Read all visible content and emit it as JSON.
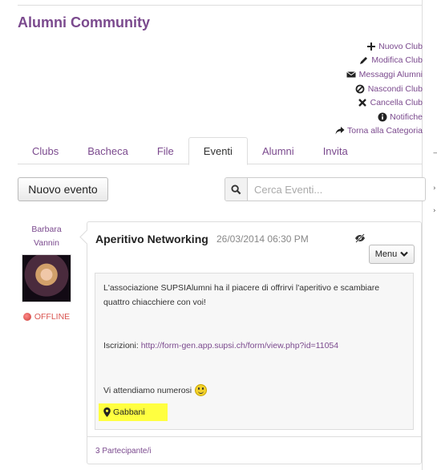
{
  "page": {
    "title": "Alumni Community"
  },
  "actions": [
    {
      "label": "Nuovo Club",
      "icon": "plus-icon"
    },
    {
      "label": "Modifica Club",
      "icon": "pencil-icon"
    },
    {
      "label": "Messaggi Alumni",
      "icon": "envelope-icon"
    },
    {
      "label": "Nascondi Club",
      "icon": "ban-icon"
    },
    {
      "label": "Cancella Club",
      "icon": "close-icon"
    },
    {
      "label": "Notifiche",
      "icon": "info-icon"
    },
    {
      "label": "Torna alla Categoria",
      "icon": "share-icon"
    }
  ],
  "tabs": [
    {
      "label": "Clubs"
    },
    {
      "label": "Bacheca"
    },
    {
      "label": "File"
    },
    {
      "label": "Eventi",
      "active": true
    },
    {
      "label": "Alumni"
    },
    {
      "label": "Invita"
    }
  ],
  "toolbar": {
    "new_event_label": "Nuovo evento"
  },
  "search": {
    "placeholder": "Cerca Eventi..."
  },
  "author": {
    "first_name": "Barbara",
    "last_name": "Vannin",
    "status": "OFFLINE"
  },
  "event": {
    "title": "Aperitivo Networking",
    "date": "26/03/2014 06:30 PM",
    "menu_label": "Menu",
    "intro": "L'associazione SUPSIAlumni ha il piacere di offrirvi l'aperitivo e  scambiare quattro chiacchiere con voi!",
    "signup_label": "Iscrizioni:",
    "signup_link": "http://form-gen.app.supsi.ch/form/view.php?id=11054",
    "closing": "Vi attendiamo numerosi",
    "location": "Gabbani",
    "participants": "3 Partecipante/i"
  },
  "colors": {
    "accent": "#7b4a8e",
    "highlight": "#ffff40",
    "offline": "#d9534f"
  }
}
